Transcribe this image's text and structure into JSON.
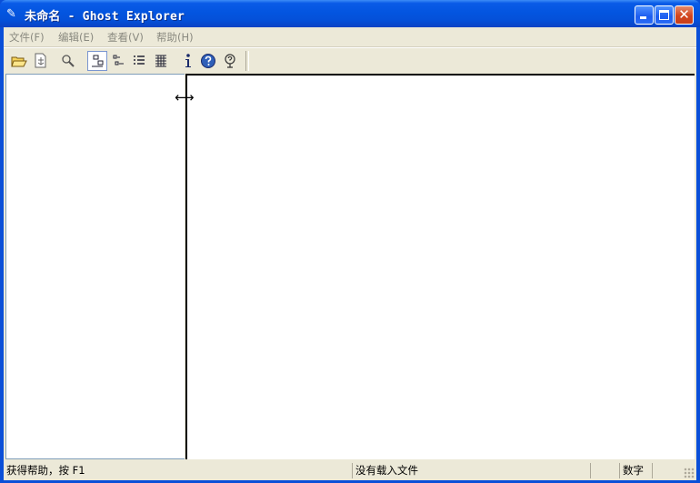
{
  "window": {
    "title": "未命名 - Ghost Explorer"
  },
  "menu": [
    {
      "label": "文件(F)"
    },
    {
      "label": "编辑(E)"
    },
    {
      "label": "查看(V)"
    },
    {
      "label": "帮助(H)"
    }
  ],
  "toolbar": {
    "buttons": [
      {
        "icon": "open-folder-icon"
      },
      {
        "icon": "extract-icon"
      },
      {
        "icon": "find-icon"
      },
      {
        "icon": "large-icons-view-icon",
        "pressed": true
      },
      {
        "icon": "small-icons-view-icon"
      },
      {
        "icon": "list-view-icon"
      },
      {
        "icon": "details-view-icon"
      },
      {
        "icon": "info-icon"
      },
      {
        "icon": "help-icon"
      },
      {
        "icon": "whats-this-icon"
      }
    ]
  },
  "status": {
    "help_text": "获得帮助，按 F1",
    "file_status": "没有载入文件",
    "num_lock": "数字"
  },
  "colors": {
    "titlebar": "#0355e0",
    "frame": "#ece9d8",
    "pane_background": "#ffffff"
  }
}
